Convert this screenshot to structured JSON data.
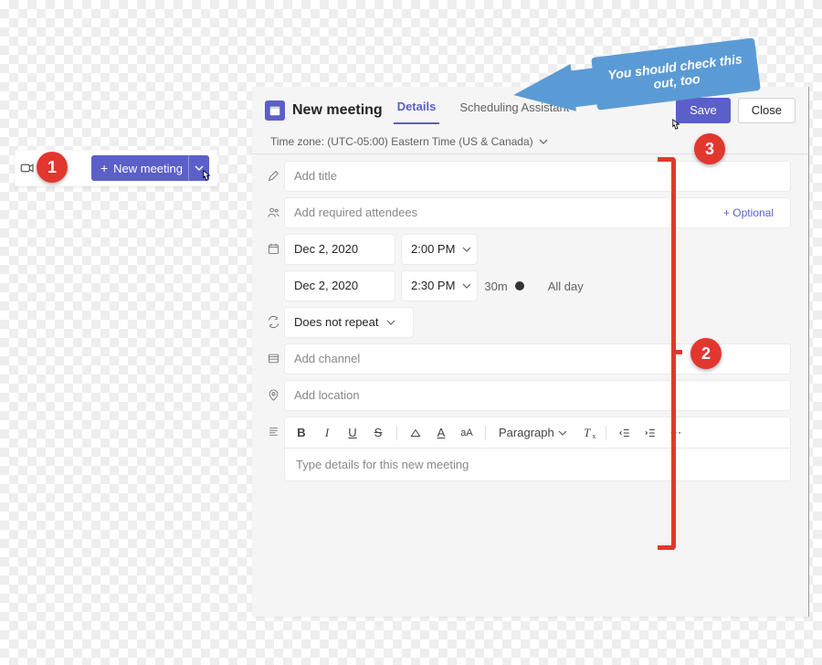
{
  "colors": {
    "accent": "#5b5fc7",
    "annotation_red": "#e2372e",
    "arrow_blue": "#5b9bd5"
  },
  "callout_button": {
    "label": "New meeting"
  },
  "header": {
    "title": "New meeting",
    "tabs": {
      "details": "Details",
      "scheduling": "Scheduling Assistant"
    },
    "save": "Save",
    "close": "Close"
  },
  "timezone": "Time zone: (UTC-05:00) Eastern Time (US & Canada)",
  "form": {
    "title_placeholder": "Add title",
    "attendees_placeholder": "Add required attendees",
    "optional_link": "+ Optional",
    "start_date": "Dec 2, 2020",
    "start_time": "2:00 PM",
    "end_date": "Dec 2, 2020",
    "end_time": "2:30 PM",
    "duration": "30m",
    "all_day": "All day",
    "repeat": "Does not repeat",
    "channel_placeholder": "Add channel",
    "location_placeholder": "Add location",
    "details_placeholder": "Type details for this new meeting",
    "paragraph_label": "Paragraph"
  },
  "annotations": {
    "num1": "1",
    "num2": "2",
    "num3": "3",
    "arrow_text": "You should check this out, too"
  }
}
